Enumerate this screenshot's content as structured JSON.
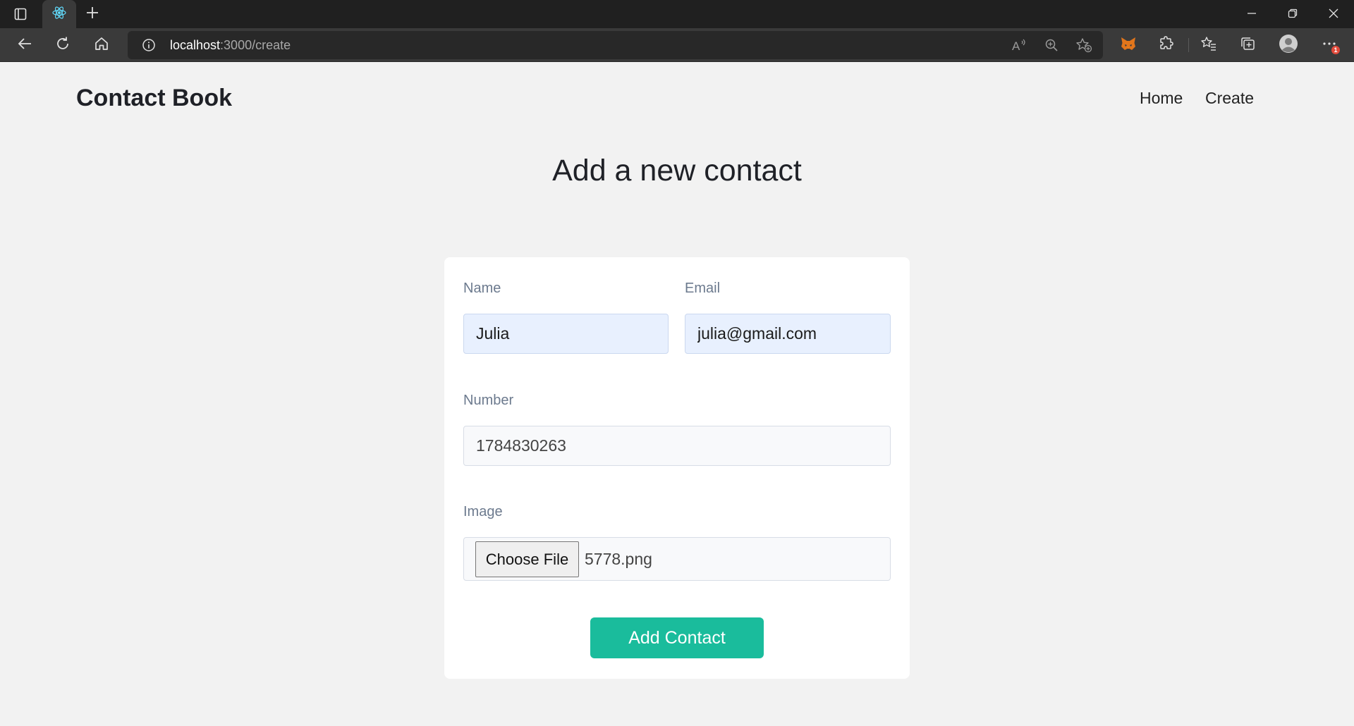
{
  "browser": {
    "url_host": "localhost",
    "url_path": ":3000/create",
    "notification_count": "1"
  },
  "nav": {
    "brand": "Contact Book",
    "links": [
      "Home",
      "Create"
    ]
  },
  "page": {
    "title": "Add a new contact"
  },
  "form": {
    "name_label": "Name",
    "name_value": "Julia",
    "email_label": "Email",
    "email_value": "julia@gmail.com",
    "number_label": "Number",
    "number_value": "1784830263",
    "image_label": "Image",
    "file_button_label": "Choose File",
    "file_name": "5778.png",
    "submit_label": "Add Contact"
  },
  "colors": {
    "accent": "#1abc9c",
    "autofill_bg": "#e8f0fe",
    "page_bg": "#f2f2f2"
  },
  "icons": [
    "tab-actions-icon",
    "react-favicon-icon",
    "plus-icon",
    "minimize-icon",
    "restore-icon",
    "close-icon",
    "back-arrow-icon",
    "refresh-icon",
    "home-icon",
    "info-icon",
    "read-aloud-icon",
    "zoom-icon",
    "add-favorite-icon",
    "metamask-fox-icon",
    "extensions-icon",
    "favorites-icon",
    "collections-icon",
    "profile-icon",
    "more-icon"
  ]
}
